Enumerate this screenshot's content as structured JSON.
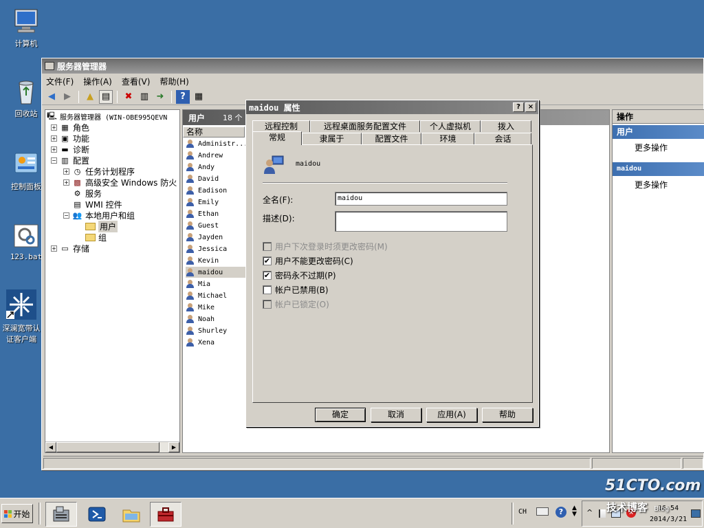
{
  "desktop": {
    "icons": [
      {
        "label": "计算机"
      },
      {
        "label": "回收站"
      },
      {
        "label": "控制面板"
      },
      {
        "label": "123.bat"
      },
      {
        "label": "深澜宽带认证客户端"
      }
    ]
  },
  "window": {
    "title": "服务器管理器",
    "menu": [
      "文件(F)",
      "操作(A)",
      "查看(V)",
      "帮助(H)"
    ]
  },
  "tree": {
    "root": "服务器管理器 (WIN-OBE995QEVN",
    "items": [
      {
        "label": "角色"
      },
      {
        "label": "功能"
      },
      {
        "label": "诊断"
      },
      {
        "label": "配置"
      },
      {
        "label": "任务计划程序"
      },
      {
        "label": "高级安全 Windows 防火"
      },
      {
        "label": "服务"
      },
      {
        "label": "WMI 控件"
      },
      {
        "label": "本地用户和组"
      },
      {
        "label": "用户"
      },
      {
        "label": "组"
      },
      {
        "label": "存储"
      }
    ]
  },
  "users": {
    "header": "用户",
    "count": "18 个",
    "column": "名称",
    "list": [
      "Administr...",
      "Andrew",
      "Andy",
      "David",
      "Eadison",
      "Emily",
      "Ethan",
      "Guest",
      "Jayden",
      "Jessica",
      "Kevin",
      "maidou",
      "Mia",
      "Michael",
      "Mike",
      "Noah",
      "Shurley",
      "Xena"
    ]
  },
  "actions": {
    "header": "操作",
    "section1": "用户",
    "more1": "更多操作",
    "section2": "maidou",
    "more2": "更多操作"
  },
  "dialog": {
    "title": "maidou 属性",
    "help": "?",
    "close": "×",
    "tabs_row1": [
      "远程控制",
      "远程桌面服务配置文件",
      "个人虚拟机",
      "拨入"
    ],
    "tabs_row2": [
      "常规",
      "隶属于",
      "配置文件",
      "环境",
      "会话"
    ],
    "username": "maidou",
    "fullname_label": "全名(F):",
    "fullname_value": "maidou",
    "desc_label": "描述(D):",
    "desc_value": "",
    "checkboxes": [
      {
        "label": "用户下次登录时须更改密码(M)"
      },
      {
        "label": "用户不能更改密码(C)"
      },
      {
        "label": "密码永不过期(P)"
      },
      {
        "label": "帐户已禁用(B)"
      },
      {
        "label": "帐户已锁定(O)"
      }
    ],
    "buttons": [
      "确定",
      "取消",
      "应用(A)",
      "帮助"
    ]
  },
  "taskbar": {
    "start": "开始",
    "lang": "CH",
    "time": "16:54",
    "date": "2014/3/21"
  },
  "watermark": {
    "line1": "51CTO.com",
    "line2": "技术博客",
    "line3": "Blog"
  }
}
